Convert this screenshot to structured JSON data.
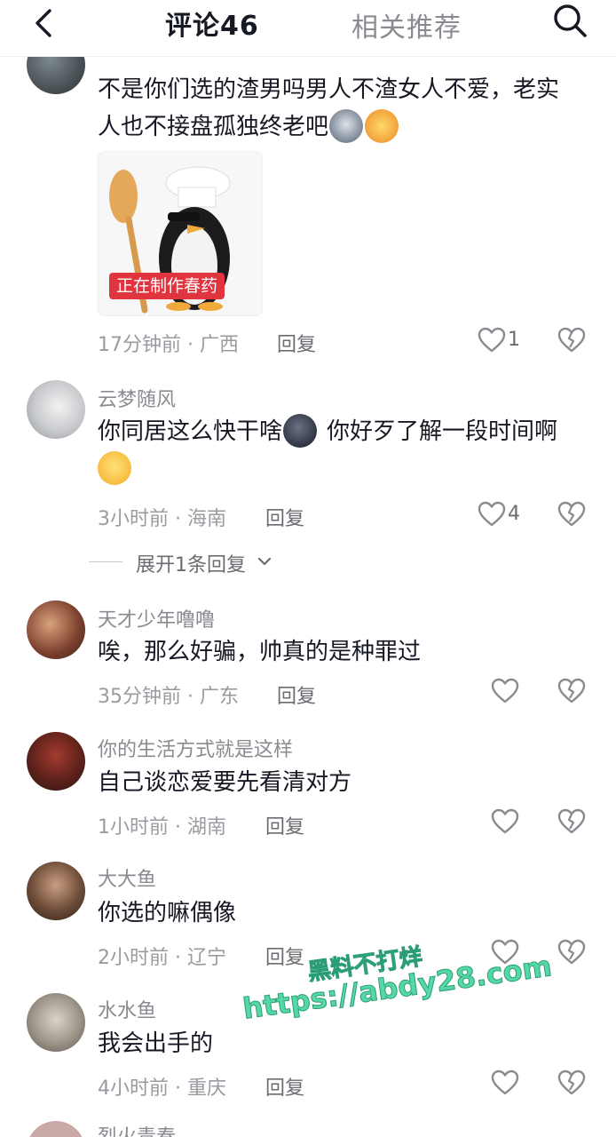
{
  "header": {
    "tab_comments": "评论46",
    "tab_recommend": "相关推荐"
  },
  "colors": {
    "heart_outline": "#8a8b91",
    "sticker_tag": "#e0343f",
    "watermark": "#56d7a6"
  },
  "comments": [
    {
      "username": "",
      "text_line1": "不是你们选的渣男吗男人不渣女人不爱，老实",
      "text_line2": "人也不接盘孤独终老吧",
      "emojis": [
        "wolf-emoji",
        "party-emoji"
      ],
      "sticker_caption": "正在制作春药",
      "time": "17分钟前",
      "location": "广西",
      "reply_label": "回复",
      "likes": "1"
    },
    {
      "username": "云梦随风",
      "text_line1": "你同居这么快干啥",
      "text_line1b": "你好歹了解一段时间啊",
      "emojis": [
        "dark-moon-emoji",
        "smile-emoji"
      ],
      "time": "3小时前",
      "location": "海南",
      "reply_label": "回复",
      "likes": "4"
    },
    {
      "username": "天才少年噜噜",
      "text": "唉，那么好骗，帅真的是种罪过",
      "time": "35分钟前",
      "location": "广东",
      "reply_label": "回复"
    },
    {
      "username": "你的生活方式就是这样",
      "text": "自己谈恋爱要先看清对方",
      "time": "1小时前",
      "location": "湖南",
      "reply_label": "回复"
    },
    {
      "username": "大大鱼",
      "text": "你选的嘛偶像",
      "time": "2小时前",
      "location": "辽宁",
      "reply_label": "回复"
    },
    {
      "username": "水水鱼",
      "text": "我会出手的",
      "time": "4小时前",
      "location": "重庆",
      "reply_label": "回复"
    },
    {
      "username": "烈火青春"
    }
  ],
  "expand_replies": "展开1条回复",
  "watermark": {
    "line1": "黑料不打烊",
    "line2": "https://abdy28.com"
  }
}
